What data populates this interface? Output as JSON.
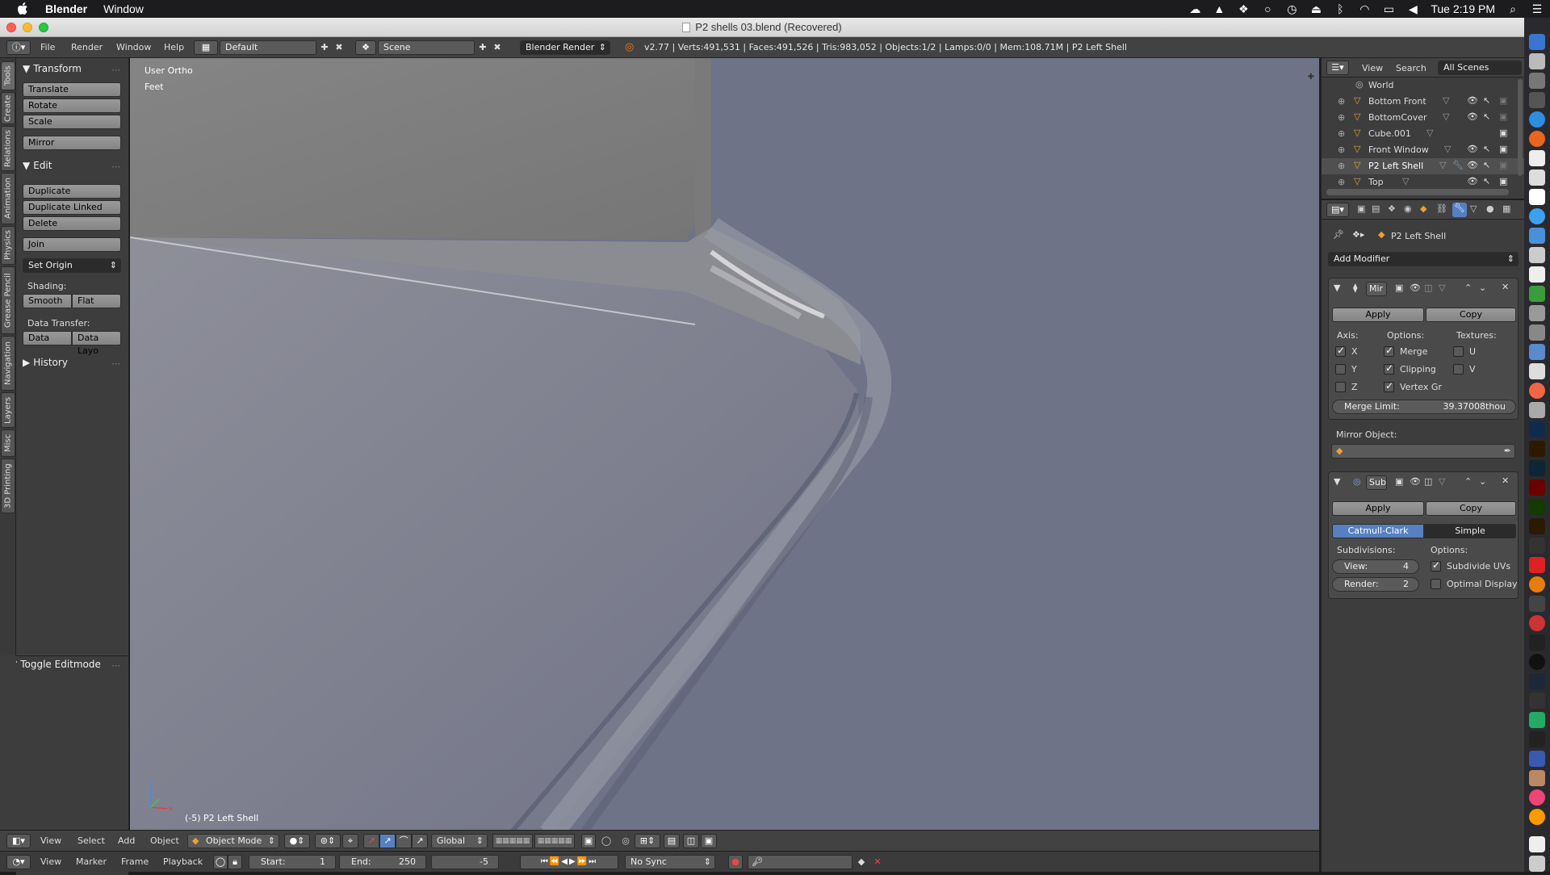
{
  "menubar": {
    "app": "Blender",
    "window": "Window",
    "clock": "Tue 2:19 PM"
  },
  "window": {
    "title": "P2 shells 03.blend (Recovered)"
  },
  "info_header": {
    "menus": [
      "File",
      "Render",
      "Window",
      "Help"
    ],
    "layout": "Default",
    "scene": "Scene",
    "engine": "Blender Render",
    "stats": "v2.77 | Verts:491,531 | Faces:491,526 | Tris:983,052 | Objects:1/2 | Lamps:0/0 | Mem:108.71M | P2 Left Shell"
  },
  "tabs": [
    "Tools",
    "Create",
    "Relations",
    "Animation",
    "Physics",
    "Grease Pencil",
    "Navigation",
    "Layers",
    "Misc",
    "3D Printing"
  ],
  "toolshelf": {
    "transform": "Transform",
    "translate": "Translate",
    "rotate": "Rotate",
    "scale": "Scale",
    "mirror": "Mirror",
    "edit": "Edit",
    "duplicate": "Duplicate",
    "duplicate_linked": "Duplicate Linked",
    "delete": "Delete",
    "join": "Join",
    "set_origin": "Set Origin",
    "shading": "Shading:",
    "smooth": "Smooth",
    "flat": "Flat",
    "data_transfer": "Data Transfer:",
    "data": "Data",
    "data_layo": "Data Layo",
    "history": "History",
    "toggle_editmode": "Toggle Editmode"
  },
  "viewport": {
    "view_name": "User Ortho",
    "units": "Feet",
    "object_label": "(-5) P2 Left Shell"
  },
  "viewport_header": {
    "menus": [
      "View",
      "Select",
      "Add",
      "Object"
    ],
    "mode": "Object Mode",
    "orientation": "Global"
  },
  "timeline": {
    "menus": [
      "View",
      "Marker",
      "Frame",
      "Playback"
    ],
    "start": "Start:",
    "start_val": "1",
    "end": "End:",
    "end_val": "250",
    "current": "-5",
    "sync": "No Sync"
  },
  "outliner": {
    "view": "View",
    "search": "Search",
    "scenes": "All Scenes",
    "items": [
      "World",
      "Bottom Front",
      "BottomCover",
      "Cube.001",
      "Front Window",
      "P2 Left Shell",
      "Top"
    ]
  },
  "properties": {
    "object_name": "P2 Left Shell",
    "add_modifier": "Add Modifier",
    "mirror": {
      "name": "Mir",
      "apply": "Apply",
      "copy": "Copy",
      "axis": "Axis:",
      "options": "Options:",
      "textures": "Textures:",
      "x": "X",
      "y": "Y",
      "z": "Z",
      "merge": "Merge",
      "clipping": "Clipping",
      "vertex_gr": "Vertex Gr",
      "u": "U",
      "v": "V",
      "merge_limit": "Merge Limit:",
      "merge_limit_val": "39.37008thou",
      "mirror_object": "Mirror Object:"
    },
    "subsurf": {
      "name": "Sub",
      "apply": "Apply",
      "copy": "Copy",
      "catmull": "Catmull-Clark",
      "simple": "Simple",
      "subdivisions": "Subdivisions:",
      "options": "Options:",
      "view": "View:",
      "view_val": "4",
      "render": "Render:",
      "render_val": "2",
      "subdivide_uvs": "Subdivide UVs",
      "optimal_display": "Optimal Display"
    }
  },
  "colors": {
    "accent": "#5680c2",
    "viewport_bg": "#6f7388",
    "panel": "#3d3d3d"
  }
}
